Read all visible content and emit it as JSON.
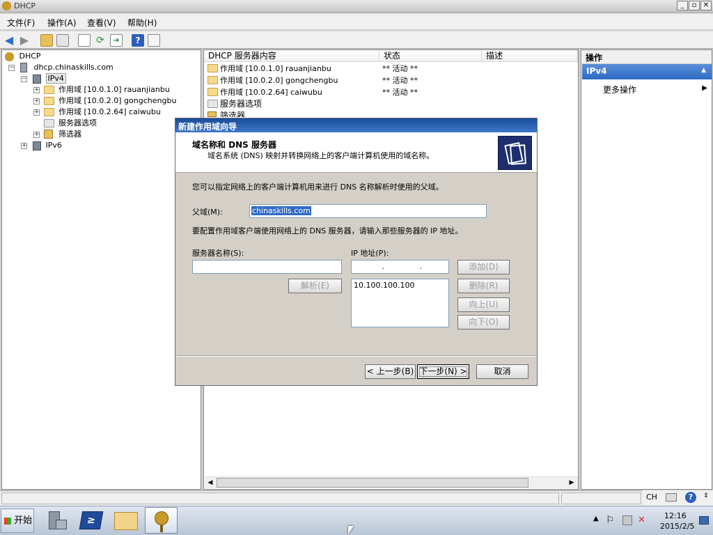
{
  "window": {
    "title": "DHCP"
  },
  "menu": {
    "file": "文件(F)",
    "action": "操作(A)",
    "view": "查看(V)",
    "help": "帮助(H)"
  },
  "tree": {
    "root": "DHCP",
    "server": "dhcp.chinaskills.com",
    "ipv4": "IPv4",
    "scope1": "作用域 [10.0.1.0] rauanjianbu",
    "scope2": "作用域 [10.0.2.0] gongchengbu",
    "scope3": "作用域 [10.0.2.64] caiwubu",
    "server_options": "服务器选项",
    "filters": "筛选器",
    "ipv6": "IPv6"
  },
  "list": {
    "columns": [
      "DHCP 服务器内容",
      "状态",
      "描述"
    ],
    "rows": [
      {
        "name": "作用域 [10.0.1.0] rauanjianbu",
        "status": "** 活动 **"
      },
      {
        "name": "作用域 [10.0.2.0] gongchengbu",
        "status": "** 活动 **"
      },
      {
        "name": "作用域 [10.0.2.64] caiwubu",
        "status": "** 活动 **"
      },
      {
        "name": "服务器选项",
        "status": ""
      },
      {
        "name": "筛选器",
        "status": ""
      }
    ]
  },
  "actions": {
    "header": "操作",
    "selected": "IPv4",
    "more": "更多操作"
  },
  "dialog": {
    "title": "新建作用域向导",
    "heading": "域名称和 DNS 服务器",
    "subheading": "域名系统 (DNS) 映射并转换网络上的客户端计算机使用的域名称。",
    "intro": "您可以指定网络上的客户端计算机用来进行 DNS 名称解析时使用的父域。",
    "parent_domain_label": "父域(M):",
    "parent_domain_value": "chinaskills.com",
    "dns_intro": "要配置作用域客户端使用网络上的 DNS 服务器，请输入那些服务器的 IP 地址。",
    "server_name_label": "服务器名称(S):",
    "ip_label": "IP 地址(P):",
    "ip_placeholder": " .   .   . ",
    "resolve": "解析(E)",
    "add": "添加(D)",
    "remove": "删除(R)",
    "up": "向上(U)",
    "down": "向下(O)",
    "ip_list": [
      "10.100.100.100"
    ],
    "back": "< 上一步(B)",
    "next": "下一步(N) >",
    "cancel": "取消"
  },
  "taskbar": {
    "start": "开始",
    "lang": "CH",
    "time": "12:16",
    "date": "2015/2/5"
  }
}
